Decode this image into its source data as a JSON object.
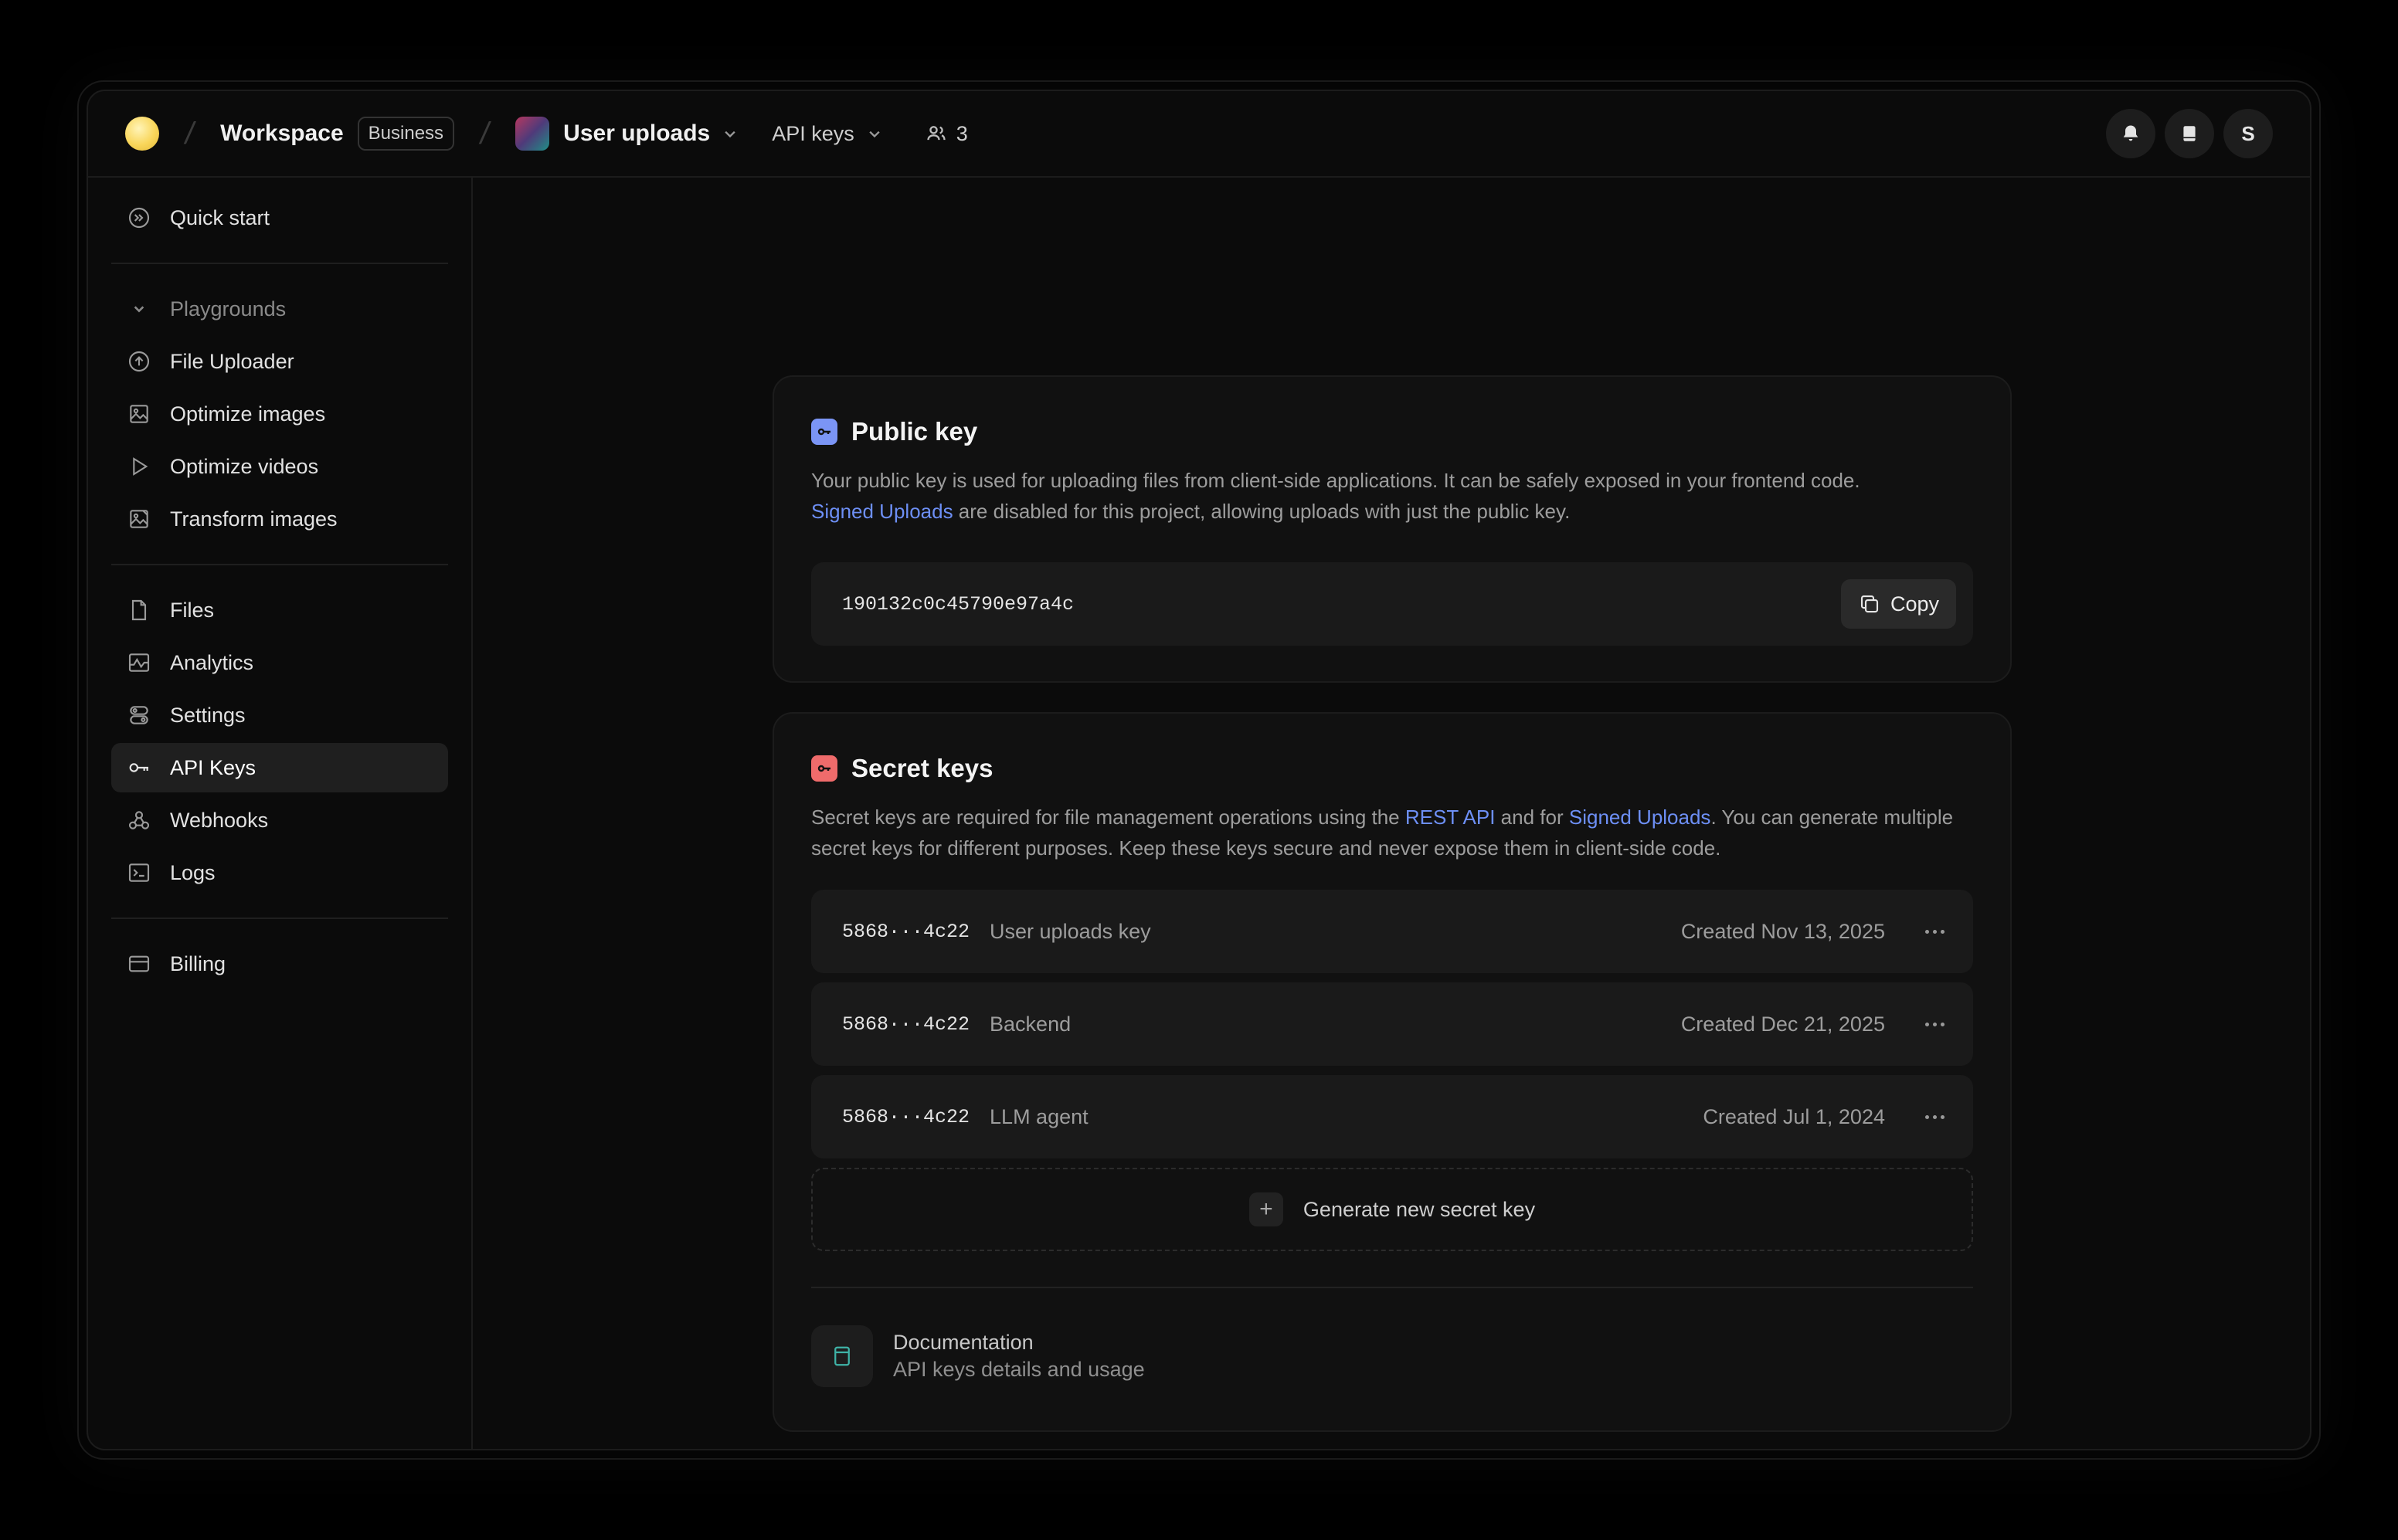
{
  "header": {
    "workspace": "Workspace",
    "plan_badge": "Business",
    "project": "User uploads",
    "section_dropdown": "API keys",
    "members_count": "3",
    "avatar_initial": "S"
  },
  "sidebar": {
    "quick_start": "Quick start",
    "group_label": "Playgrounds",
    "playgrounds": [
      {
        "label": "File Uploader",
        "icon": "upload-icon"
      },
      {
        "label": "Optimize images",
        "icon": "image-icon"
      },
      {
        "label": "Optimize videos",
        "icon": "play-icon"
      },
      {
        "label": "Transform images",
        "icon": "image-transform-icon"
      }
    ],
    "items": [
      {
        "label": "Files",
        "icon": "file-icon"
      },
      {
        "label": "Analytics",
        "icon": "analytics-icon"
      },
      {
        "label": "Settings",
        "icon": "settings-icon"
      },
      {
        "label": "API Keys",
        "icon": "key-icon"
      },
      {
        "label": "Webhooks",
        "icon": "webhook-icon"
      },
      {
        "label": "Logs",
        "icon": "terminal-icon"
      }
    ],
    "billing": "Billing"
  },
  "public_key": {
    "title": "Public key",
    "desc_1": "Your public key is used for uploading files from client-side applications. It can be safely exposed in your frontend code.",
    "desc_link": "Signed Uploads",
    "desc_2": " are disabled for this project, allowing uploads with just the public key.",
    "value": "190132c0c45790e97a4c",
    "copy_label": "Copy"
  },
  "secret_keys": {
    "title": "Secret keys",
    "desc_1": "Secret keys are required for file management operations using the ",
    "link_rest": "REST API",
    "desc_2": " and for ",
    "link_signed": "Signed Uploads",
    "desc_3": ". You can generate multiple secret keys for different purposes. Keep these keys secure and never expose them in client-side code.",
    "keys": [
      {
        "masked": "5868···4c22",
        "name": "User uploads key",
        "created": "Created Nov 13, 2025"
      },
      {
        "masked": "5868···4c22",
        "name": "Backend",
        "created": "Created Dec 21, 2025"
      },
      {
        "masked": "5868···4c22",
        "name": "LLM agent",
        "created": "Created Jul 1, 2024"
      }
    ],
    "generate_label": "Generate new secret key",
    "doc_title": "Documentation",
    "doc_subtitle": "API keys details and usage"
  },
  "colors": {
    "link": "#6d8ff5",
    "public_key_icon": "#7b95f5",
    "secret_key_icon": "#ef6b6b",
    "doc_icon": "#3fb3a7"
  }
}
